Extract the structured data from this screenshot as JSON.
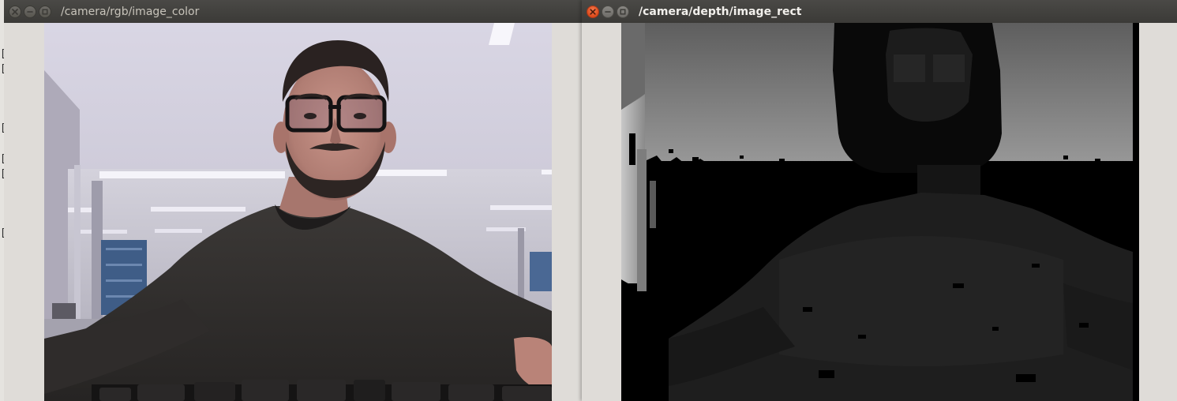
{
  "windows": [
    {
      "title": "/camera/rgb/image_color",
      "active": false,
      "image": "rgb-camera-feed"
    },
    {
      "title": "/camera/depth/image_rect",
      "active": true,
      "image": "depth-camera-feed"
    }
  ],
  "controls": {
    "close_icon": "close-icon",
    "minimize_icon": "minimize-icon",
    "maximize_icon": "maximize-icon"
  },
  "colors": {
    "titlebar": "#3b3a37",
    "close_active": "#de4b1b",
    "client_background": "#dfdcd8"
  }
}
